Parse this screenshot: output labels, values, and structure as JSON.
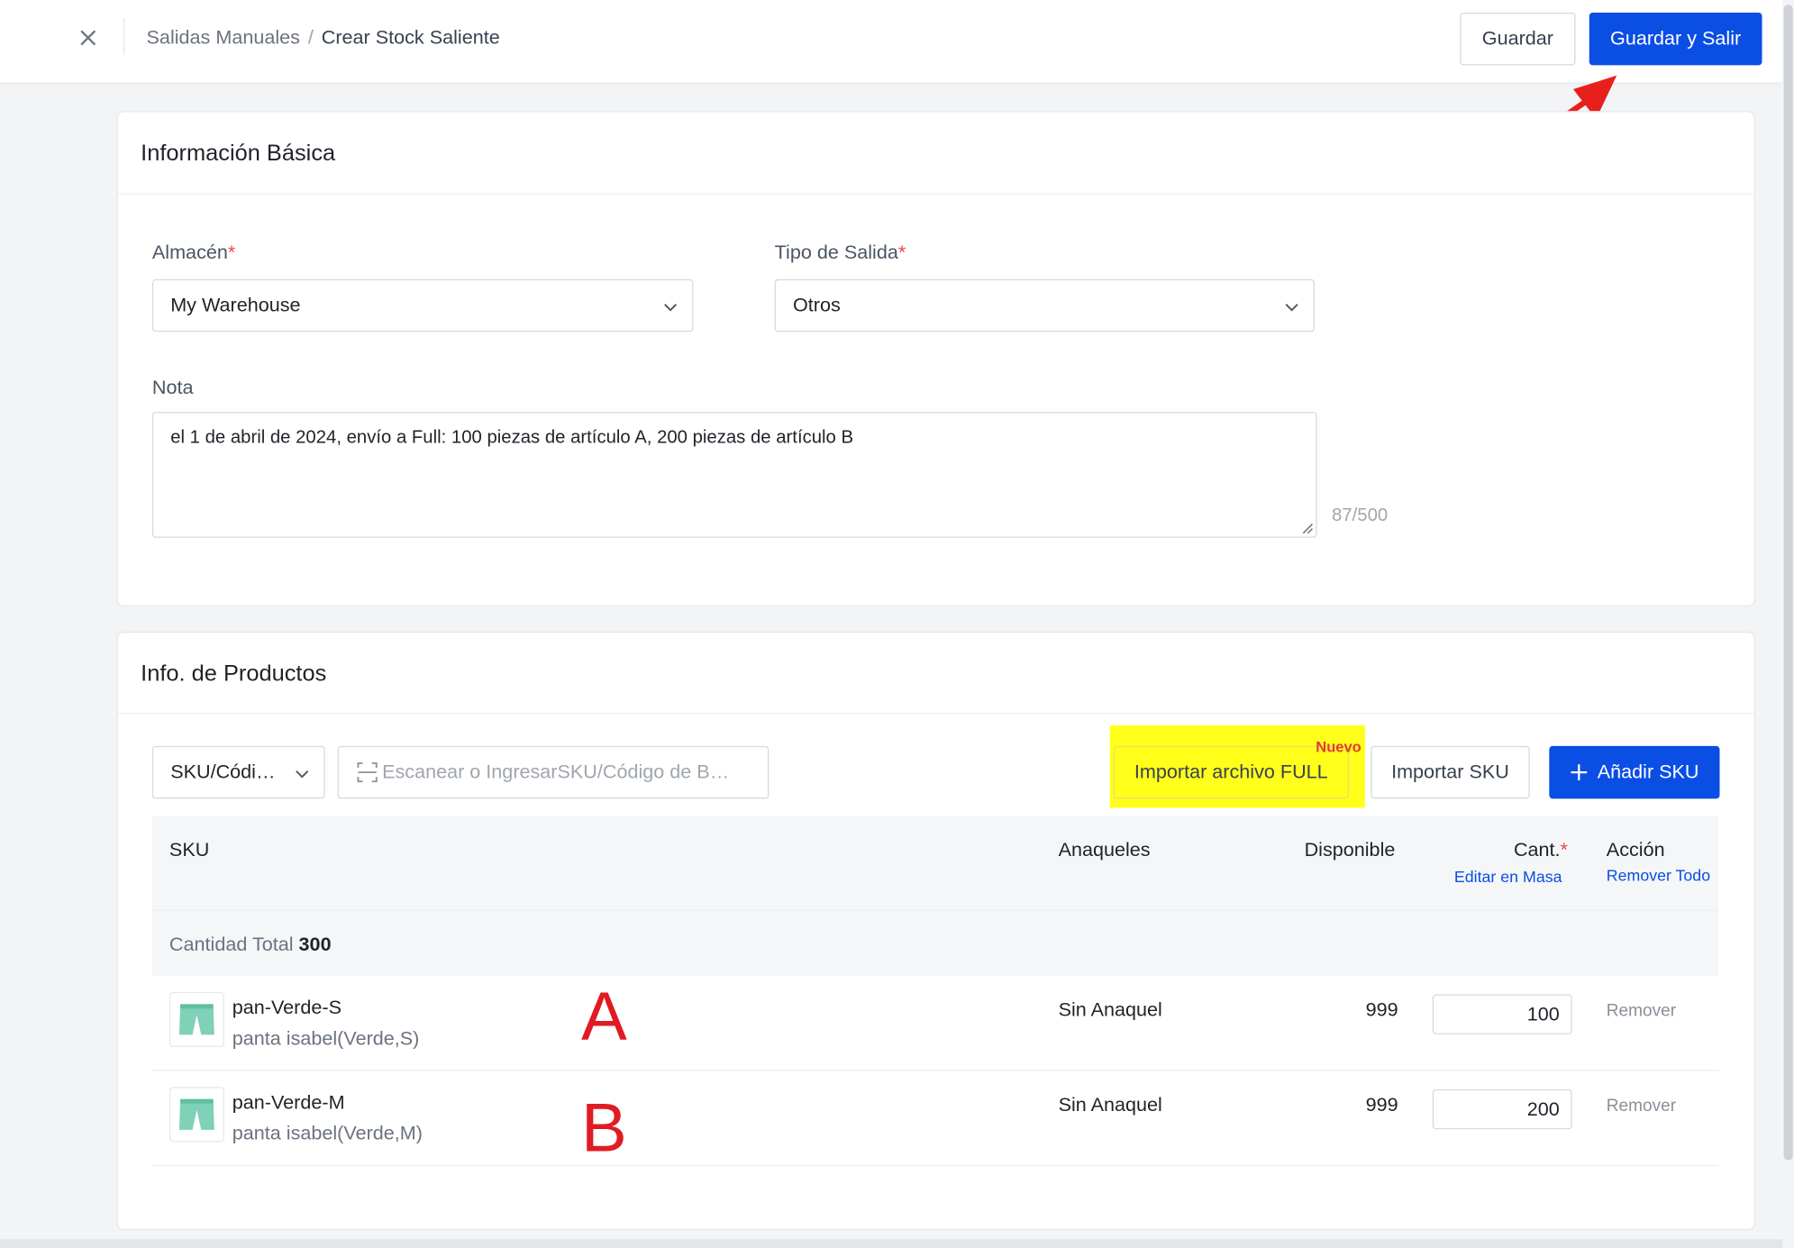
{
  "breadcrumb": {
    "parent": "Salidas Manuales",
    "separator": "/",
    "current": "Crear Stock Saliente"
  },
  "header": {
    "save_label": "Guardar",
    "save_exit_label": "Guardar y Salir"
  },
  "basic_info": {
    "title": "Información Básica",
    "warehouse": {
      "label": "Almacén",
      "required_mark": "*",
      "value": "My Warehouse"
    },
    "exit_type": {
      "label": "Tipo de Salida",
      "required_mark": "*",
      "value": "Otros"
    },
    "note": {
      "label": "Nota",
      "value": "el 1 de abril de 2024, envío a Full: 100 piezas de artículo A, 200 piezas de artículo B",
      "counter": "87/500"
    }
  },
  "products": {
    "title": "Info. de Productos",
    "search_type": "SKU/Códi…",
    "scan_placeholder": "Escanear o IngresarSKU/Código de B…",
    "import_full_label": "Importar archivo FULL",
    "new_badge": "Nuevo",
    "import_sku_label": "Importar SKU",
    "add_sku_label": "Añadir SKU",
    "columns": {
      "sku": "SKU",
      "shelves": "Anaqueles",
      "available": "Disponible",
      "qty": "Cant.",
      "qty_required": "*",
      "bulk_edit": "Editar en Masa",
      "action": "Acción",
      "remove_all": "Remover Todo"
    },
    "total": {
      "label": "Cantidad Total",
      "value": "300"
    },
    "rows": [
      {
        "code": "pan-Verde-S",
        "name": "panta isabel(Verde,S)",
        "marker": "A",
        "shelf": "Sin Anaquel",
        "available": "999",
        "qty": "100",
        "remove": "Remover"
      },
      {
        "code": "pan-Verde-M",
        "name": "panta isabel(Verde,M)",
        "marker": "B",
        "shelf": "Sin Anaquel",
        "available": "999",
        "qty": "200",
        "remove": "Remover"
      }
    ]
  },
  "colors": {
    "primary": "#0a4ee4",
    "highlight": "#ffff1a",
    "annotation": "#e01b24"
  }
}
